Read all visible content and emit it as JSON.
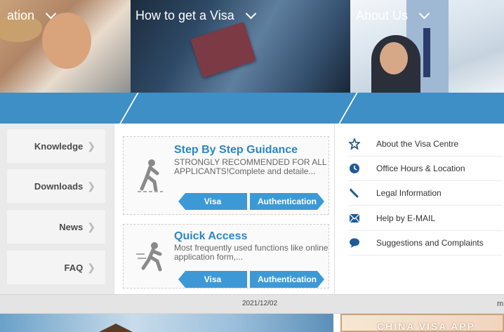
{
  "nav": {
    "item1": "ation",
    "item2": "How to get a Visa",
    "item3": "About Us"
  },
  "left_menu": [
    {
      "label": "Knowledge"
    },
    {
      "label": "Downloads"
    },
    {
      "label": "News"
    },
    {
      "label": "FAQ"
    }
  ],
  "cards": [
    {
      "title": "Step By Step Guidance",
      "desc": "STRONGLY RECOMMENDED FOR ALL APPLICANTS!Complete and detaile...",
      "btn_visa": "Visa",
      "btn_auth": "Authentication"
    },
    {
      "title": "Quick Access",
      "desc": "Most frequently used functions like online application form,...",
      "btn_visa": "Visa",
      "btn_auth": "Authentication"
    }
  ],
  "about_links": [
    {
      "label": "About the Visa Centre",
      "icon": "star-icon"
    },
    {
      "label": "Office Hours & Location",
      "icon": "clock-icon"
    },
    {
      "label": "Legal Information",
      "icon": "gavel-icon"
    },
    {
      "label": "Help by E-MAIL",
      "icon": "email-icon"
    },
    {
      "label": "Suggestions and Complaints",
      "icon": "chat-icon"
    }
  ],
  "date_bar": {
    "date": "2021/12/02",
    "right_text": "m"
  },
  "banner": {
    "text": "CHINA VISA APP"
  },
  "colors": {
    "nav_blue": "#3e8fc5",
    "accent_blue": "#2b86c4",
    "tag_blue": "#3d99d6"
  }
}
